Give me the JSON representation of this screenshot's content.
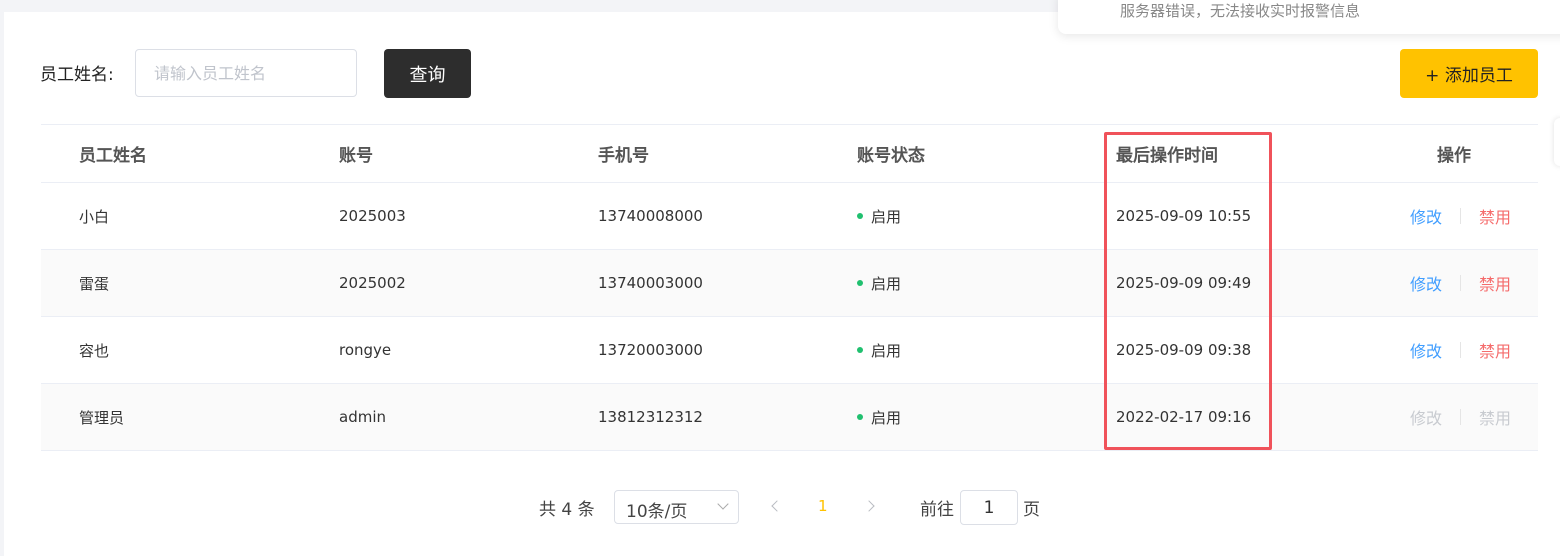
{
  "notification": {
    "text": "服务器错误，无法接收实时报警信息"
  },
  "search": {
    "label": "员工姓名:",
    "placeholder": "请输入员工姓名",
    "value": "",
    "button_label": "查询"
  },
  "toolbar": {
    "add_label": "+ 添加员工"
  },
  "table": {
    "columns": [
      "员工姓名",
      "账号",
      "手机号",
      "账号状态",
      "最后操作时间",
      "操作"
    ],
    "rows": [
      {
        "name": "小白",
        "account": "2025003",
        "phone": "13740008000",
        "status": "启用",
        "last_time": "2025-09-09 10:55",
        "edit": "修改",
        "disable": "禁用"
      },
      {
        "name": "雷蛋",
        "account": "2025002",
        "phone": "13740003000",
        "status": "启用",
        "last_time": "2025-09-09 09:49",
        "edit": "修改",
        "disable": "禁用"
      },
      {
        "name": "容也",
        "account": "rongye",
        "phone": "13720003000",
        "status": "启用",
        "last_time": "2025-09-09 09:38",
        "edit": "修改",
        "disable": "禁用"
      },
      {
        "name": "管理员",
        "account": "admin",
        "phone": "13812312312",
        "status": "启用",
        "last_time": "2022-02-17 09:16",
        "edit": "修改",
        "disable": "禁用"
      }
    ]
  },
  "pagination": {
    "total": "共 4 条",
    "page_size": "10条/页",
    "current_page": "1",
    "goto_label": "前往",
    "goto_value": "1",
    "goto_suffix": "页"
  },
  "colors": {
    "primary_button": "#2d2d2d",
    "accent": "#ffc200",
    "status_active": "#20c06f",
    "edit_link": "#419eff",
    "disable_link": "#f56c6c",
    "highlight_border": "#f0525a"
  }
}
